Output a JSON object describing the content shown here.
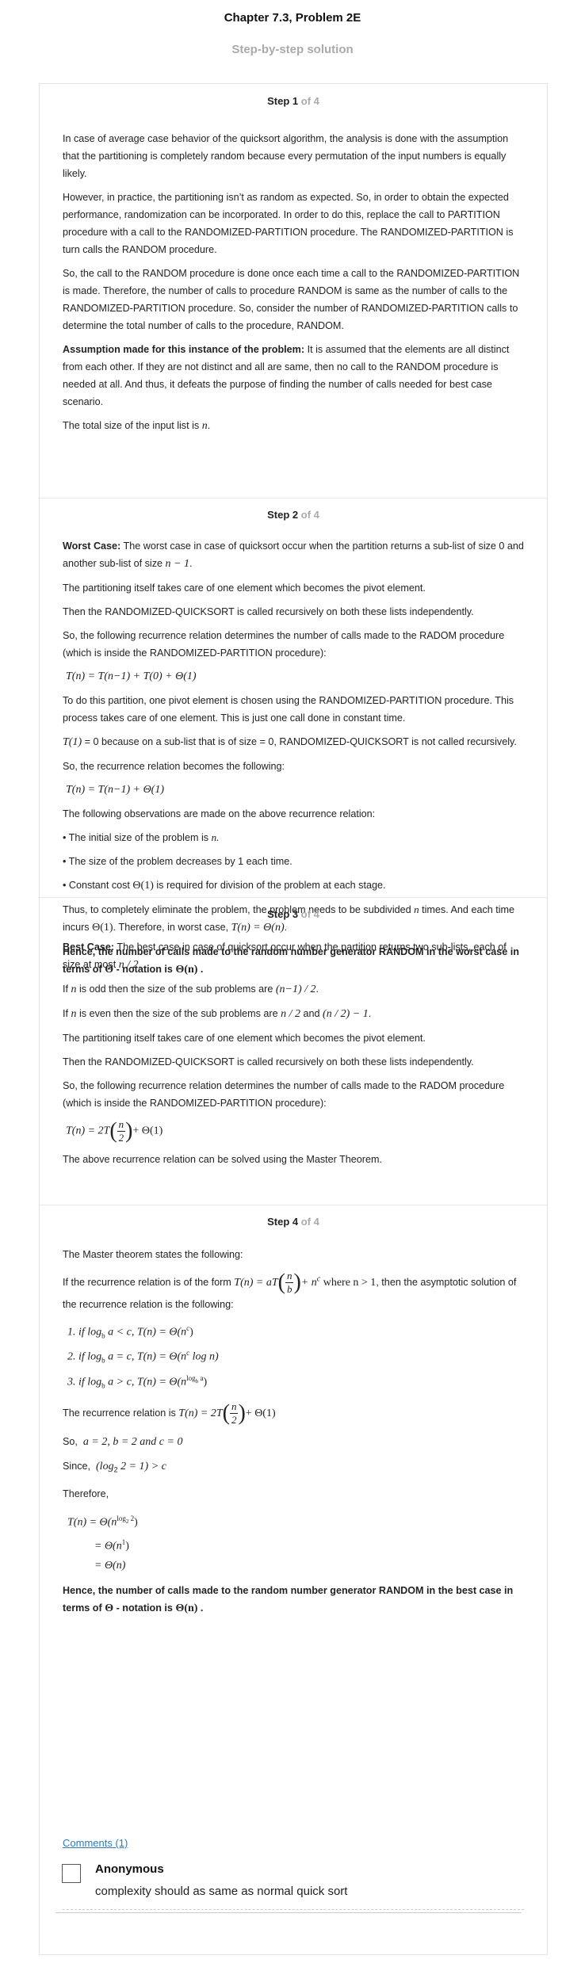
{
  "header": {
    "title": "Chapter 7.3, Problem 2E",
    "subtitle": "Step-by-step solution"
  },
  "steps": [
    {
      "label": "Step 1",
      "of": "of 4"
    },
    {
      "label": "Step 2",
      "of": "of 4"
    },
    {
      "label": "Step 3",
      "of": "of 4"
    },
    {
      "label": "Step 4",
      "of": "of 4"
    }
  ],
  "s1": {
    "p1": "In case of average case behavior of the quicksort algorithm, the analysis is done with the assumption that the partitioning is completely random because every permutation of the input numbers is equally likely.",
    "p2": "However, in practice, the partitioning isn’t as random as expected. So, in order to obtain the expected performance, randomization can be incorporated. In order to do this, replace the call to PARTITION procedure with a call to the RANDOMIZED-PARTITION procedure. The RANDOMIZED-PARTITION is turn calls the RANDOM procedure.",
    "p3": "So, the call to the RANDOM procedure is done once each time a call to the RANDOMIZED-PARTITION is made. Therefore, the number of calls to procedure RANDOM is same as the number of calls to the RANDOMIZED-PARTITION procedure. So, consider the number of RANDOMIZED-PARTITION calls to determine the total number of calls to the procedure, RANDOM.",
    "p4_bold": "Assumption made for this instance of the problem:",
    "p4": " It is assumed that the elements are all distinct from each other. If they are not distinct and all are same, then no call to the RANDOM procedure is needed at all. And thus, it defeats the purpose of finding the number of calls needed for best case scenario.",
    "p5": "The total size of the input list is",
    "p5_math": "n"
  },
  "s2": {
    "p1_bold": "Worst Case:",
    "p1": " The worst case in case of quicksort occur when the partition returns a sub-list of size 0 and another sub-list of size",
    "p1_math": "n − 1",
    "p2": "The partitioning itself takes care of one element which becomes the pivot element.",
    "p3": "Then the RANDOMIZED-QUICKSORT is called recursively on both these lists independently.",
    "p4": "So, the following recurrence relation determines the number of calls made to the RADOM procedure (which is inside the RANDOMIZED-PARTITION procedure):",
    "eq1": "T(n) = T(n−1) + T(0) + Θ(1)",
    "p5": "To do this partition, one pivot element is chosen using the RANDOMIZED-PARTITION procedure. This process takes care of one element. This is just one call done in constant time.",
    "p6_math": "T(1)",
    "p6": " = 0 because on a sub-list that is of size = 0, RANDOMIZED-QUICKSORT is not called recursively.",
    "p7": "So, the recurrence relation becomes the following:",
    "eq2": "T(n) = T(n−1) + Θ(1)",
    "p8": "The following observations are made on the above recurrence relation:",
    "b1": "• The initial size of the problem is",
    "b1_math": "n.",
    "b2": "• The size of the problem decreases by 1 each time.",
    "b3a": "• Constant cost",
    "b3_math": "Θ(1)",
    "b3b": " is required for division of the problem at each stage.",
    "p9a": "Thus, to completely eliminate the problem, the problem needs to be subdivided",
    "p9_n": "n",
    "p9b": " times. And each time incurs",
    "p9_m1": "Θ(1)",
    "p9c": ". Therefore, in worst case,",
    "p9_m2": "T(n) = Θ(n)",
    "c1": "Hence, the number of calls made to the random number generator RANDOM in the worst case in terms of",
    "c_theta": "Θ",
    "c2": " - notation is",
    "c_val": "Θ(n)"
  },
  "s3": {
    "p1_bold": "Best Case:",
    "p1": " The best case in case of quicksort occur when the partition returns two sub-lists, each of size at most",
    "p1_math": "n / 2",
    "p2a": "If",
    "p2_n": "n",
    "p2b": " is odd then the size of the sub problems are",
    "p2_math": "(n−1) / 2",
    "p3a": "If",
    "p3_n": "n",
    "p3b": " is even then the size of the sub problems are",
    "p3_m1": "n / 2",
    "p3_and": "and",
    "p3_m2": "(n / 2) − 1",
    "p4": "The partitioning itself takes care of one element which becomes the pivot element.",
    "p5": "Then the RANDOMIZED-QUICKSORT is called recursively on both these lists independently.",
    "p6": "So, the following recurrence relation determines the number of calls made to the RADOM procedure (which is inside the RANDOMIZED-PARTITION procedure):",
    "eq_lhs": "T(n) = 2T",
    "eq_num": "n",
    "eq_den": "2",
    "eq_rhs": "+ Θ(1)",
    "p7": "The above recurrence relation can be solved using the Master Theorem."
  },
  "s4": {
    "p1": "The Master theorem states the following:",
    "p2a": "If the recurrence relation is of the form",
    "p2_lhs": "T(n) = aT",
    "p2_num": "n",
    "p2_den": "b",
    "p2_rhs": "+ n",
    "p2_sup": "c",
    "p2_where": " where n > 1",
    "p2b": ", then the asymptotic solution of the recurrence relation is the following:",
    "r1": "1. if log",
    "r1b": " a < c, T(n) = Θ(n",
    "r2": "2. if log",
    "r2b": " a = c, T(n) = Θ(n",
    "r2c": " log n)",
    "r3": "3. if log",
    "r3b": " a > c, T(n) = Θ(n",
    "sub_b": "b",
    "sup_c": "c",
    "sup_logba": "log",
    "p3": "The recurrence relation is",
    "p3_lhs": "T(n) = 2T",
    "p3_num": "n",
    "p3_den": "2",
    "p3_rhs": "+ Θ(1)",
    "p4a": "So,",
    "p4_math": "a = 2, b = 2 and c = 0",
    "p5a": "Since,",
    "p5_math": "(log",
    "p5_math2": " 2 = 1) > c",
    "p6": "Therefore,",
    "t1": "T(n) = Θ(n",
    "t1_sup": "log",
    "t1_sub": "2",
    "t1_sup2": " 2",
    "t2": "= Θ(n",
    "t2_sup": "1",
    "t3": "= Θ(n)",
    "c1": "Hence, the number of calls made to the random number generator RANDOM in the best case in terms of",
    "c_theta": "Θ",
    "c2": " - notation is",
    "c_val": "Θ(n)"
  },
  "comments": {
    "link": "Comments (1)",
    "author": "Anonymous",
    "text": "complexity should as same as normal quick sort"
  }
}
